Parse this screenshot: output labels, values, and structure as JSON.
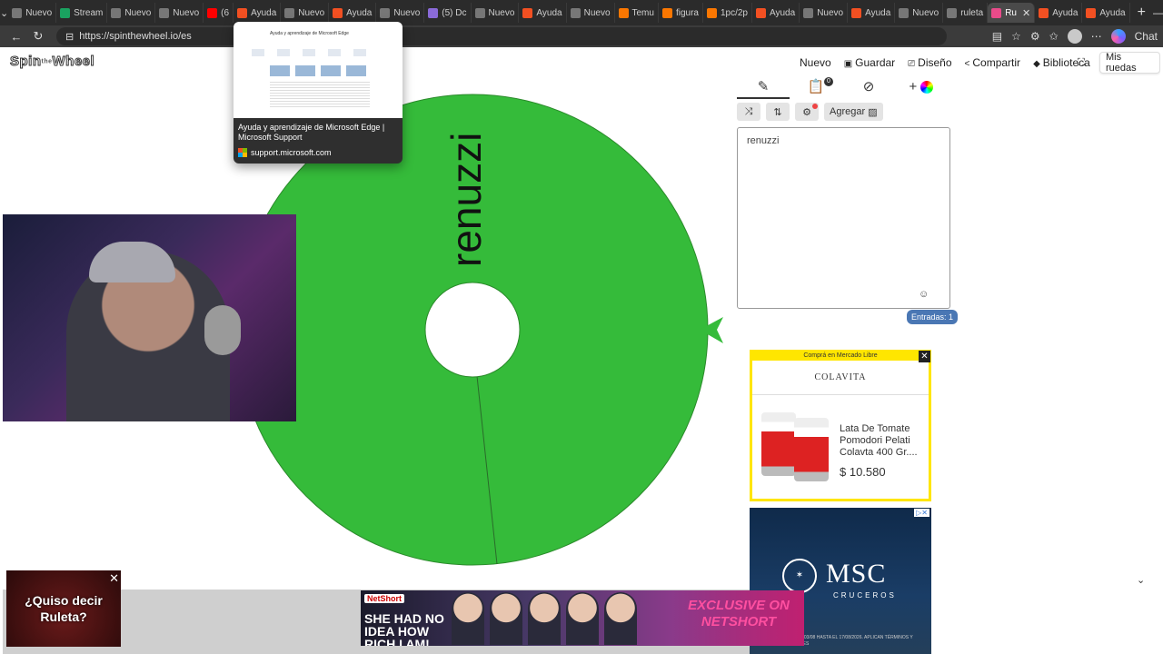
{
  "browser": {
    "tabs": [
      {
        "label": "Nuevo",
        "color": "#777777"
      },
      {
        "label": "Stream",
        "color": "#1aa260"
      },
      {
        "label": "Nuevo",
        "color": "#777777"
      },
      {
        "label": "Nuevo",
        "color": "#777777"
      },
      {
        "label": "(6",
        "color": "#ff0000"
      },
      {
        "label": "Ayuda",
        "color": "#f25022"
      },
      {
        "label": "Nuevo",
        "color": "#777777"
      },
      {
        "label": "Ayuda",
        "color": "#f25022"
      },
      {
        "label": "Nuevo",
        "color": "#777777"
      },
      {
        "label": "(5) Dc",
        "color": "#8a6ad8"
      },
      {
        "label": "Nuevo",
        "color": "#777777"
      },
      {
        "label": "Ayuda",
        "color": "#f25022"
      },
      {
        "label": "Nuevo",
        "color": "#777777"
      },
      {
        "label": "Temu",
        "color": "#fb7701"
      },
      {
        "label": "figura",
        "color": "#fb7701"
      },
      {
        "label": "1pc/2p",
        "color": "#fb7701"
      },
      {
        "label": "Ayuda",
        "color": "#f25022"
      },
      {
        "label": "Nuevo",
        "color": "#777777"
      },
      {
        "label": "Ayuda",
        "color": "#f25022"
      },
      {
        "label": "Nuevo",
        "color": "#777777"
      },
      {
        "label": "ruleta",
        "color": "#777777"
      },
      {
        "label": "Ru",
        "color": "#e94b8a",
        "active": true
      },
      {
        "label": "Ayuda",
        "color": "#f25022"
      },
      {
        "label": "Ayuda",
        "color": "#f25022"
      }
    ],
    "url": "https://spinthewheel.io/es",
    "chat_label": "Chat"
  },
  "tab_preview": {
    "title": "Ayuda y aprendizaje de Microsoft Edge | Microsoft Support",
    "site": "support.microsoft.com",
    "thumb_heading": "Ayuda y aprendizaje de Microsoft Edge"
  },
  "site": {
    "logo_left": "Spin",
    "logo_mid": "the",
    "logo_right": "Wheel",
    "menu": [
      {
        "icon": "",
        "label": "Nuevo"
      },
      {
        "icon": "▣",
        "label": "Guardar"
      },
      {
        "icon": "⎚",
        "label": "Diseño"
      },
      {
        "icon": "<",
        "label": "Compartir"
      },
      {
        "icon": "◆",
        "label": "Biblioteca"
      }
    ],
    "fullscreen_icon": "⛶",
    "my_wheels": "Mis ruedas"
  },
  "wheel": {
    "segment_label": "renuzzi",
    "color": "#35bb3a",
    "pointer_color": "#35bb3a"
  },
  "panel": {
    "tab_badge": "0",
    "toolbar": {
      "add_label": "Agregar"
    },
    "entries_text": "renuzzi",
    "entries_count": "Entradas: 1"
  },
  "ads": {
    "ml_header": "Comprá en Mercado Libre",
    "ml_brand": "COLAVITA",
    "ml_product": "Lata De Tomate Pomodori Pelati Colavta 400 Gr....",
    "ml_price": "$ 10.580",
    "msc_name": "MSC",
    "msc_sub": "CRUCEROS",
    "msc_legal": "VÁLIDA DEL 03/08 HASTA EL 17/08/2026. APLICAN TÉRMINOS Y CONDICIONES",
    "suggest_text": "¿Quiso decir Ruleta?",
    "ns_brand": "NetShort",
    "ns_left": "SHE HAD NO IDEA HOW RICH I AM!",
    "ns_right": "EXCLUSIVE ON NETSHORT"
  }
}
